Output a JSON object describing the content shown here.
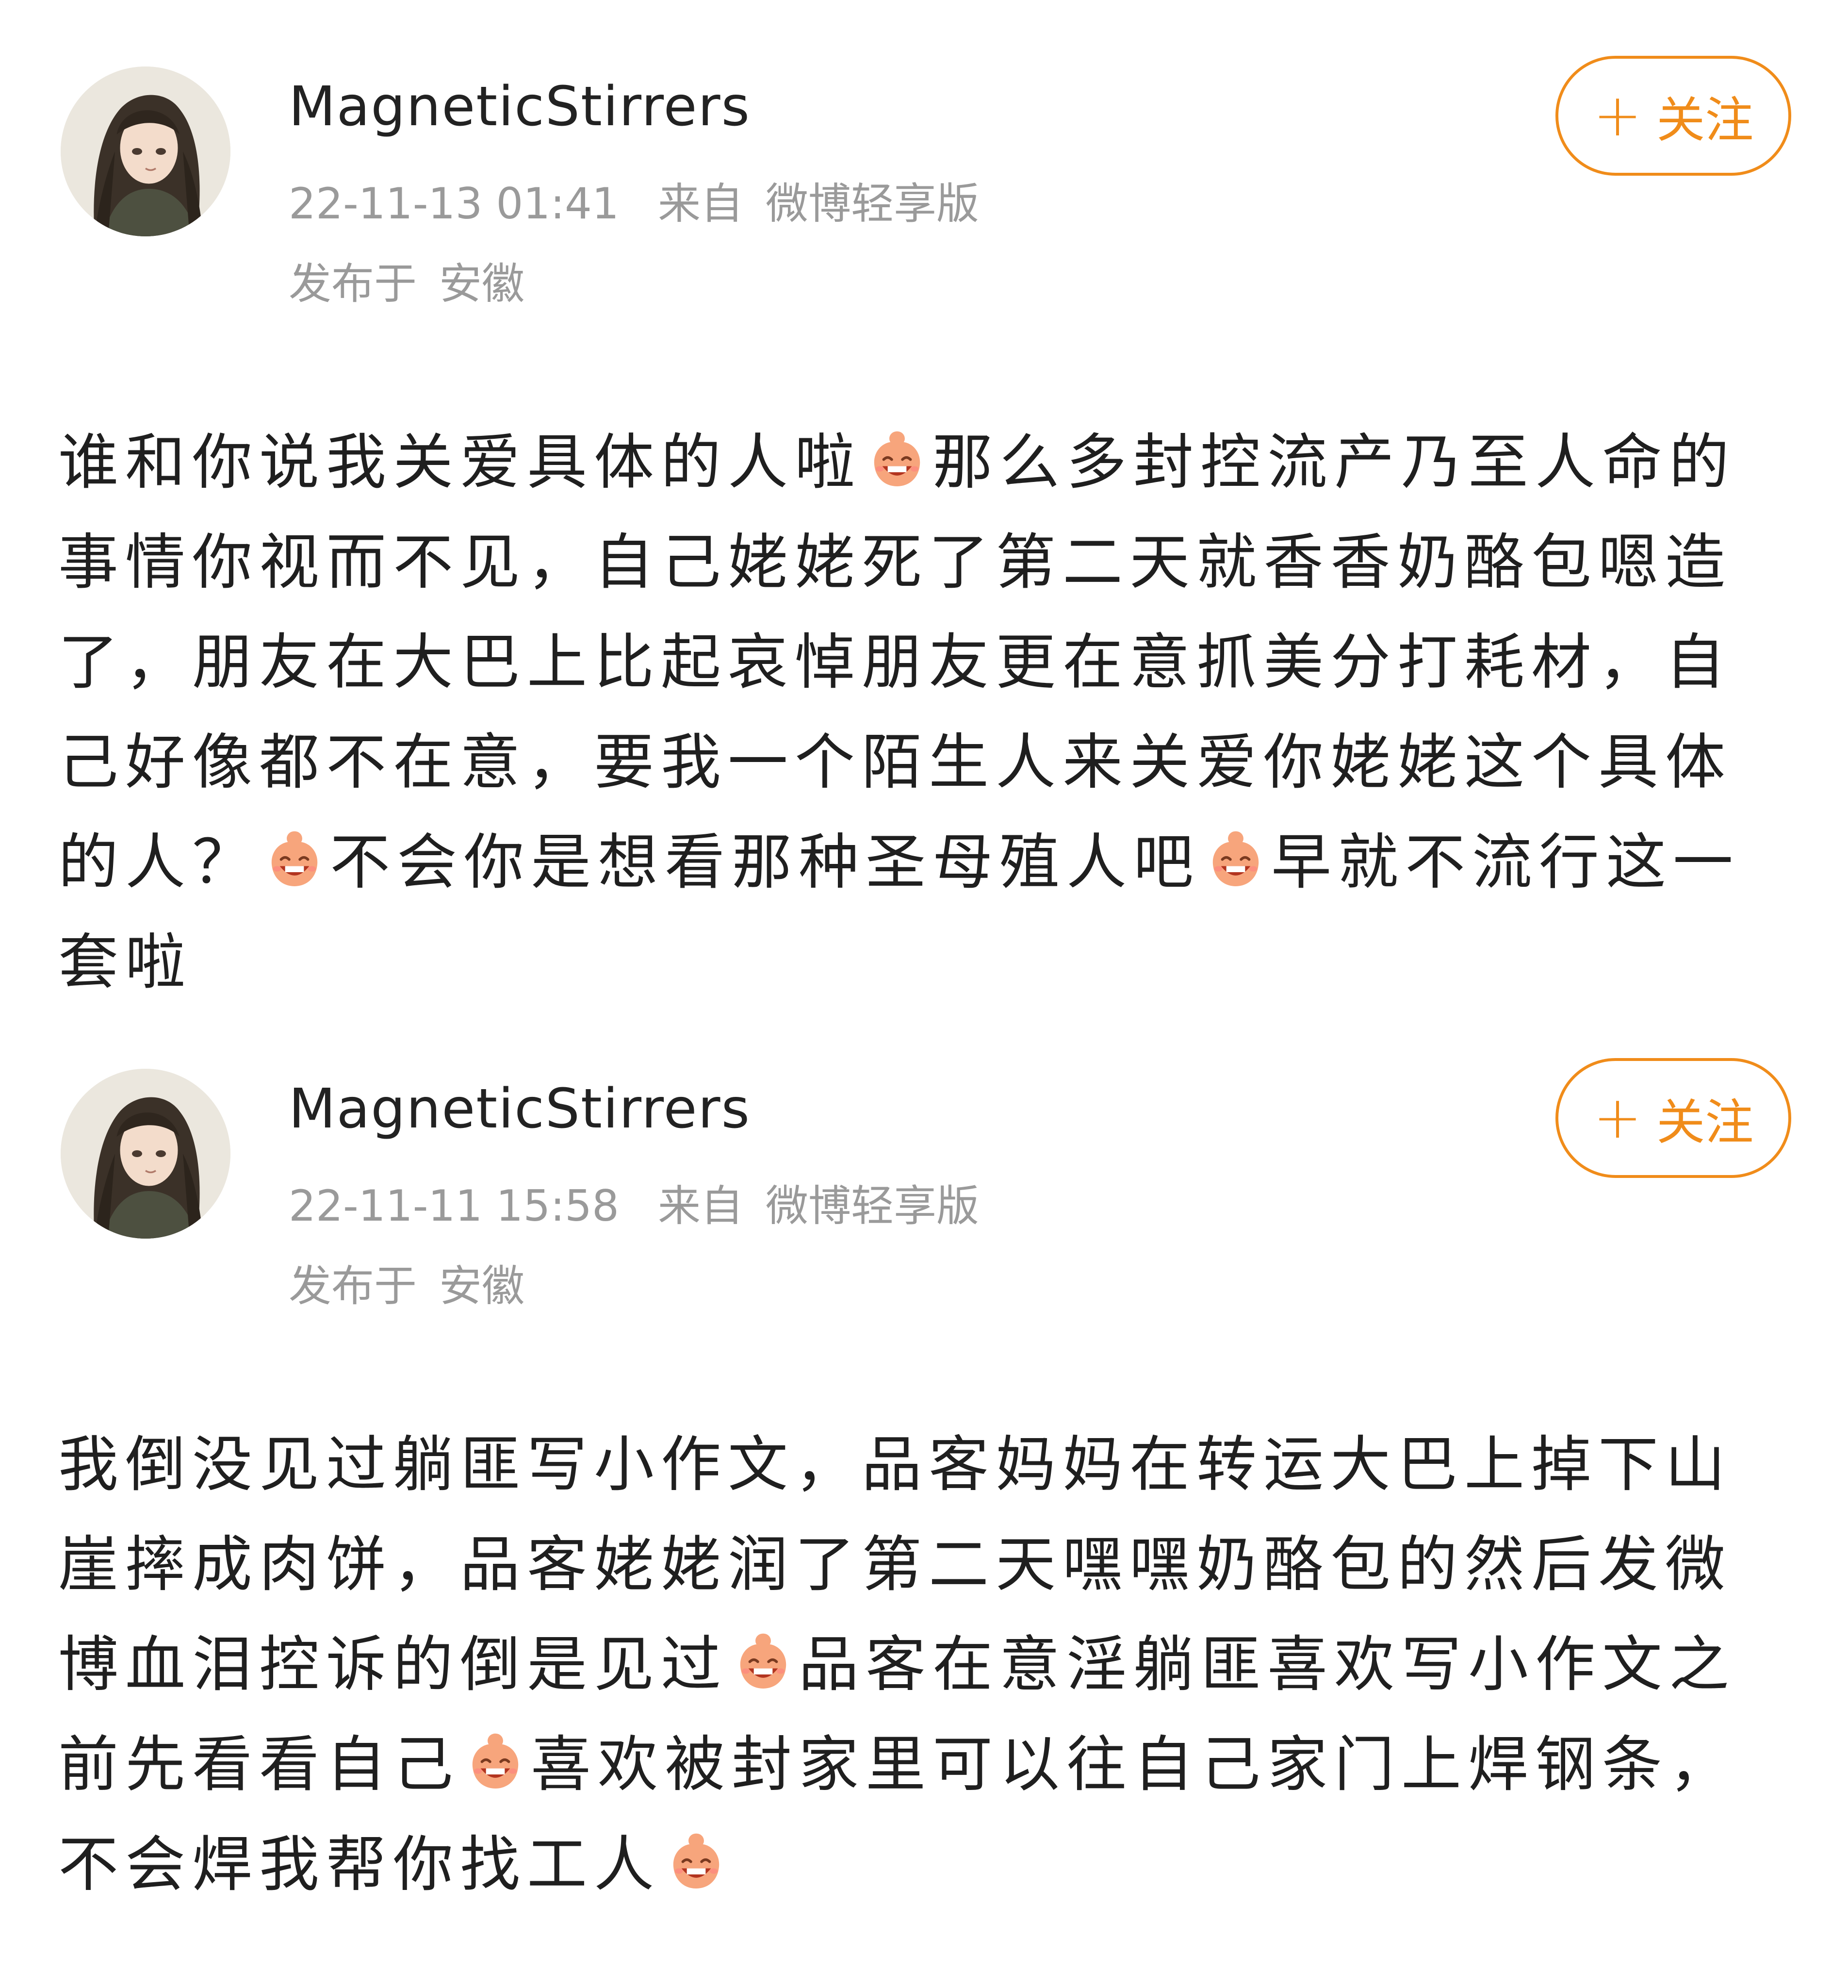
{
  "posts": [
    {
      "username": "MagneticStirrers",
      "time": "22-11-13 01:41",
      "source_label": "来自",
      "source": "微博轻享版",
      "location_label": "发布于",
      "location": "安徽",
      "follow_label": "关注",
      "content_parts": [
        "谁和你说我关爱具体的人啦",
        "那么多封控流产乃至人命的事情你视而不见，自己姥姥死了第二天就香香奶酪包嗯造了，朋友在大巴上比起哀悼朋友更在意抓美分打耗材，自己好像都不在意，要我一个陌生人来关爱你姥姥这个具体的人？",
        "不会你是想看那种圣母殖人吧",
        "早就不流行这一套啦"
      ]
    },
    {
      "username": "MagneticStirrers",
      "time": "22-11-11 15:58",
      "source_label": "来自",
      "source": "微博轻享版",
      "location_label": "发布于",
      "location": "安徽",
      "follow_label": "关注",
      "content_parts": [
        "我倒没见过躺匪写小作文，品客妈妈在转运大巴上掉下山崖摔成肉饼，品客姥姥润了第二天嘿嘿奶酪包的然后发微博血泪控诉的倒是见过",
        "品客在意淫躺匪喜欢写小作文之前先看看自己",
        "喜欢被封家里可以往自己家门上焊钢条，不会焊我帮你找工人"
      ]
    }
  ],
  "colors": {
    "accent": "#f08c1a",
    "meta_text": "#9a9a9a",
    "body_text": "#1f1f1f"
  },
  "icons": {
    "avatar": "anime-girl-avatar",
    "emoji": "grinning-emoji-icon",
    "follow": "plus-icon"
  }
}
